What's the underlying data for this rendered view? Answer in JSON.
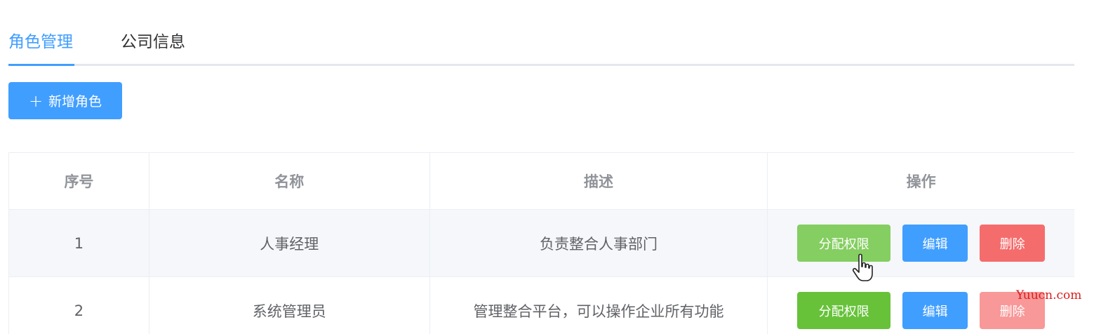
{
  "tabs": {
    "items": [
      {
        "label": "角色管理",
        "active": true
      },
      {
        "label": "公司信息",
        "active": false
      }
    ]
  },
  "toolbar": {
    "add_icon": "plus-icon",
    "add_label": "新增角色"
  },
  "table": {
    "columns": [
      "序号",
      "名称",
      "描述",
      "操作"
    ],
    "rows": [
      {
        "index": "1",
        "name": "人事经理",
        "description": "负责整合人事部门"
      },
      {
        "index": "2",
        "name": "系统管理员",
        "description": "管理整合平台，可以操作企业所有功能"
      }
    ],
    "actions": {
      "assign_label": "分配权限",
      "edit_label": "编辑",
      "delete_label": "删除"
    }
  },
  "cursor": {
    "icon": "hand-pointer-icon"
  },
  "watermark": "Yuucn.com",
  "colors": {
    "primary": "#409eff",
    "success": "#67c23a",
    "success_hover": "#85ce61",
    "danger": "#f56c6c"
  }
}
